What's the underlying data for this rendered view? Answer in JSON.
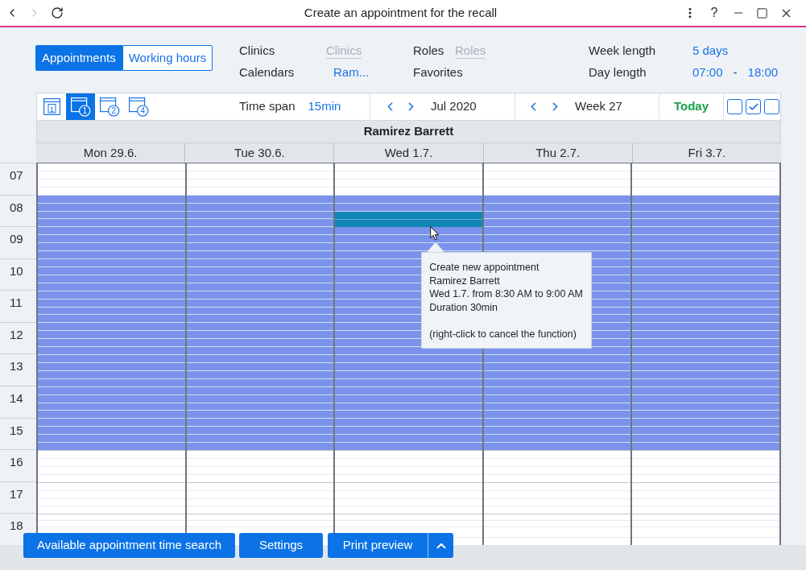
{
  "window": {
    "title": "Create an appointment for the recall",
    "nav": [
      {
        "kind": "back",
        "disabled": false
      },
      {
        "kind": "forward",
        "disabled": true
      },
      {
        "kind": "reload",
        "disabled": false
      }
    ],
    "help": "?"
  },
  "mode_tabs": [
    {
      "label": "Appointments",
      "selected": true
    },
    {
      "label": "Working hours",
      "selected": false
    }
  ],
  "filters": [
    [
      {
        "label": "Clinics",
        "value": "Clinics",
        "disabled": true
      },
      {
        "label": "Calendars",
        "value": "Ram...",
        "disabled": false
      }
    ],
    [
      {
        "label": "Roles",
        "value": "Roles",
        "disabled": true
      },
      {
        "label": "Favorites"
      }
    ]
  ],
  "week_length": {
    "label": "Week length",
    "value": "5 days"
  },
  "day_length": {
    "label": "Day length",
    "from": "07:00",
    "separator": "-",
    "to": "18:00"
  },
  "toolbar": {
    "views": [
      {
        "kind": "day",
        "digit": "1",
        "selected": false
      },
      {
        "kind": "week",
        "digit": "1",
        "selected": true
      },
      {
        "kind": "week",
        "digit": "2",
        "selected": false
      },
      {
        "kind": "week",
        "digit": "4",
        "selected": false
      }
    ],
    "time_span": {
      "label": "Time span",
      "value": "15min"
    },
    "month": "Jul 2020",
    "week": "Week 27",
    "today": "Today",
    "toggles": [
      {
        "checked": false
      },
      {
        "checked": true
      },
      {
        "checked": false
      }
    ]
  },
  "calendar": {
    "resource": "Ramirez Barrett",
    "days": [
      {
        "label": "Mon 29.6."
      },
      {
        "label": "Tue 30.6."
      },
      {
        "label": "Wed 1.7.",
        "selection": {
          "from": "8:30 AM",
          "to": "9:00 AM",
          "tooltip": {
            "title": "Create new appointment",
            "resource": "Ramirez Barrett",
            "day": "Wed 1.7.",
            "from_word": "from",
            "to_word": "to",
            "duration": "Duration 30min",
            "hint": "(right-click to cancel the function)"
          }
        }
      },
      {
        "label": "Thu 2.7."
      },
      {
        "label": "Fri 3.7."
      }
    ],
    "hours": [
      {
        "label": "07",
        "working": false
      },
      {
        "label": "08",
        "working": true
      },
      {
        "label": "09",
        "working": true
      },
      {
        "label": "10",
        "working": true
      },
      {
        "label": "11",
        "working": true
      },
      {
        "label": "12",
        "working": true
      },
      {
        "label": "13",
        "working": true
      },
      {
        "label": "14",
        "working": true
      },
      {
        "label": "15",
        "working": true
      },
      {
        "label": "16",
        "working": false
      },
      {
        "label": "17",
        "working": false
      },
      {
        "label": "18",
        "working": false
      }
    ]
  },
  "buttons": [
    {
      "kind": "plain",
      "label": "Available appointment time search"
    },
    {
      "kind": "plain",
      "label": "Settings"
    },
    {
      "kind": "split",
      "label": "Print preview"
    }
  ]
}
